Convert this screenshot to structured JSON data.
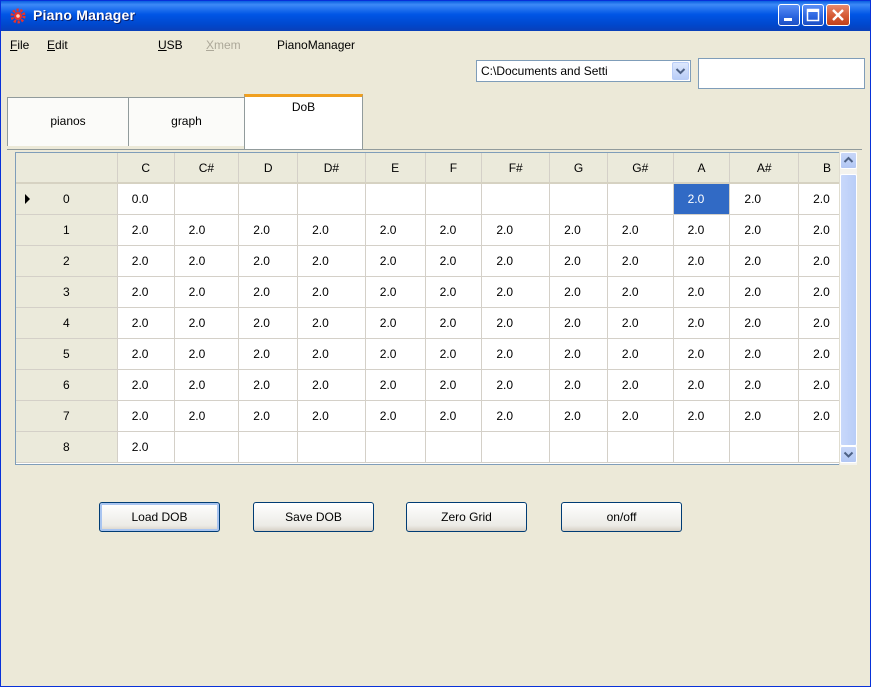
{
  "window": {
    "title": "Piano Manager"
  },
  "menu": [
    {
      "label": "File",
      "underline": "F",
      "rest": "ile",
      "disabled": false
    },
    {
      "label": "Edit",
      "underline": "E",
      "rest": "dit",
      "disabled": false
    },
    {
      "label": "USB",
      "underline": "U",
      "rest": "SB",
      "disabled": false
    },
    {
      "label": "Xmem",
      "underline": "X",
      "rest": "mem",
      "disabled": true
    },
    {
      "label": "PianoManager",
      "underline": "",
      "rest": "PianoManager",
      "disabled": false
    }
  ],
  "path_combo": {
    "value": "C:\\Documents and Setti"
  },
  "text_field": {
    "value": ""
  },
  "tabs": [
    {
      "label": "pianos",
      "active": false
    },
    {
      "label": "graph",
      "active": false
    },
    {
      "label": "DoB",
      "active": true
    }
  ],
  "grid": {
    "columns": [
      "C",
      "C#",
      "D",
      "D#",
      "E",
      "F",
      "F#",
      "G",
      "G#",
      "A",
      "A#",
      "B"
    ],
    "current_row": 0,
    "selected_cell": {
      "row": 0,
      "col": 9
    },
    "rows": [
      {
        "label": "0",
        "values": [
          "0.0",
          "",
          "",
          "",
          "",
          "",
          "",
          "",
          "",
          "2.0",
          "2.0",
          "2.0"
        ]
      },
      {
        "label": "1",
        "values": [
          "2.0",
          "2.0",
          "2.0",
          "2.0",
          "2.0",
          "2.0",
          "2.0",
          "2.0",
          "2.0",
          "2.0",
          "2.0",
          "2.0"
        ]
      },
      {
        "label": "2",
        "values": [
          "2.0",
          "2.0",
          "2.0",
          "2.0",
          "2.0",
          "2.0",
          "2.0",
          "2.0",
          "2.0",
          "2.0",
          "2.0",
          "2.0"
        ]
      },
      {
        "label": "3",
        "values": [
          "2.0",
          "2.0",
          "2.0",
          "2.0",
          "2.0",
          "2.0",
          "2.0",
          "2.0",
          "2.0",
          "2.0",
          "2.0",
          "2.0"
        ]
      },
      {
        "label": "4",
        "values": [
          "2.0",
          "2.0",
          "2.0",
          "2.0",
          "2.0",
          "2.0",
          "2.0",
          "2.0",
          "2.0",
          "2.0",
          "2.0",
          "2.0"
        ]
      },
      {
        "label": "5",
        "values": [
          "2.0",
          "2.0",
          "2.0",
          "2.0",
          "2.0",
          "2.0",
          "2.0",
          "2.0",
          "2.0",
          "2.0",
          "2.0",
          "2.0"
        ]
      },
      {
        "label": "6",
        "values": [
          "2.0",
          "2.0",
          "2.0",
          "2.0",
          "2.0",
          "2.0",
          "2.0",
          "2.0",
          "2.0",
          "2.0",
          "2.0",
          "2.0"
        ]
      },
      {
        "label": "7",
        "values": [
          "2.0",
          "2.0",
          "2.0",
          "2.0",
          "2.0",
          "2.0",
          "2.0",
          "2.0",
          "2.0",
          "2.0",
          "2.0",
          "2.0"
        ]
      },
      {
        "label": "8",
        "values": [
          "2.0",
          "",
          "",
          "",
          "",
          "",
          "",
          "",
          "",
          "",
          "",
          ""
        ]
      }
    ]
  },
  "buttons": {
    "load": "Load DOB",
    "save": "Save DOB",
    "zero": "Zero Grid",
    "onoff": "on/off"
  },
  "colors": {
    "titlebar": "#0055e5",
    "selection": "#316ac5",
    "face": "#ece9d8",
    "tab_highlight": "#f0a020"
  },
  "icons": {
    "app": "gear-icon",
    "minimize": "minimize-icon",
    "maximize": "maximize-icon",
    "close": "close-icon"
  }
}
